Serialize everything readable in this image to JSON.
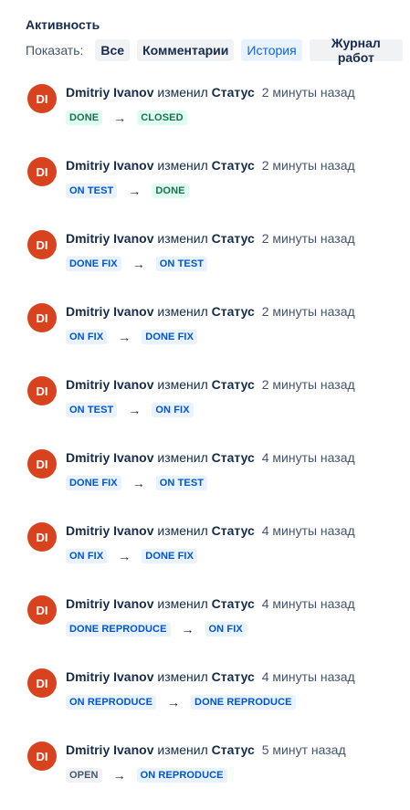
{
  "activity": {
    "title": "Активность",
    "filters_label": "Показать:",
    "filters": [
      {
        "label": "Все",
        "active": false
      },
      {
        "label": "Комментарии",
        "active": false
      },
      {
        "label": "История",
        "active": true
      },
      {
        "label": "Журнал работ",
        "active": false
      }
    ]
  },
  "colors": {
    "avatar_bg": "#d8431f",
    "done_bg": "#dcfff1",
    "done_text": "#216e4e",
    "progress_bg": "#e9f2ff",
    "progress_text": "#0055cc",
    "default_bg": "#f1f2f4",
    "default_text": "#44546f",
    "active_filter_text": "#0c66e4"
  },
  "history": [
    {
      "avatar": "DI",
      "author": "Dmitriy Ivanov",
      "verb": "изменил",
      "field": "Статус",
      "time": "2 минуты назад",
      "from": {
        "label": "DONE",
        "kind": "done"
      },
      "to": {
        "label": "CLOSED",
        "kind": "done"
      }
    },
    {
      "avatar": "DI",
      "author": "Dmitriy Ivanov",
      "verb": "изменил",
      "field": "Статус",
      "time": "2 минуты назад",
      "from": {
        "label": "ON TEST",
        "kind": "progress"
      },
      "to": {
        "label": "DONE",
        "kind": "done"
      }
    },
    {
      "avatar": "DI",
      "author": "Dmitriy Ivanov",
      "verb": "изменил",
      "field": "Статус",
      "time": "2 минуты назад",
      "from": {
        "label": "DONE FIX",
        "kind": "progress"
      },
      "to": {
        "label": "ON TEST",
        "kind": "progress"
      }
    },
    {
      "avatar": "DI",
      "author": "Dmitriy Ivanov",
      "verb": "изменил",
      "field": "Статус",
      "time": "2 минуты назад",
      "from": {
        "label": "ON FIX",
        "kind": "progress"
      },
      "to": {
        "label": "DONE FIX",
        "kind": "progress"
      }
    },
    {
      "avatar": "DI",
      "author": "Dmitriy Ivanov",
      "verb": "изменил",
      "field": "Статус",
      "time": "2 минуты назад",
      "from": {
        "label": "ON TEST",
        "kind": "progress"
      },
      "to": {
        "label": "ON FIX",
        "kind": "progress"
      }
    },
    {
      "avatar": "DI",
      "author": "Dmitriy Ivanov",
      "verb": "изменил",
      "field": "Статус",
      "time": "4 минуты назад",
      "from": {
        "label": "DONE FIX",
        "kind": "progress"
      },
      "to": {
        "label": "ON TEST",
        "kind": "progress"
      }
    },
    {
      "avatar": "DI",
      "author": "Dmitriy Ivanov",
      "verb": "изменил",
      "field": "Статус",
      "time": "4 минуты назад",
      "from": {
        "label": "ON FIX",
        "kind": "progress"
      },
      "to": {
        "label": "DONE FIX",
        "kind": "progress"
      }
    },
    {
      "avatar": "DI",
      "author": "Dmitriy Ivanov",
      "verb": "изменил",
      "field": "Статус",
      "time": "4 минуты назад",
      "from": {
        "label": "DONE REPRODUCE",
        "kind": "progress"
      },
      "to": {
        "label": "ON FIX",
        "kind": "progress"
      }
    },
    {
      "avatar": "DI",
      "author": "Dmitriy Ivanov",
      "verb": "изменил",
      "field": "Статус",
      "time": "4 минуты назад",
      "from": {
        "label": "ON REPRODUCE",
        "kind": "progress"
      },
      "to": {
        "label": "DONE REPRODUCE",
        "kind": "progress"
      }
    },
    {
      "avatar": "DI",
      "author": "Dmitriy Ivanov",
      "verb": "изменил",
      "field": "Статус",
      "time": "5 минут назад",
      "from": {
        "label": "OPEN",
        "kind": "default"
      },
      "to": {
        "label": "ON REPRODUCE",
        "kind": "progress"
      }
    }
  ],
  "arrow_glyph": "→"
}
